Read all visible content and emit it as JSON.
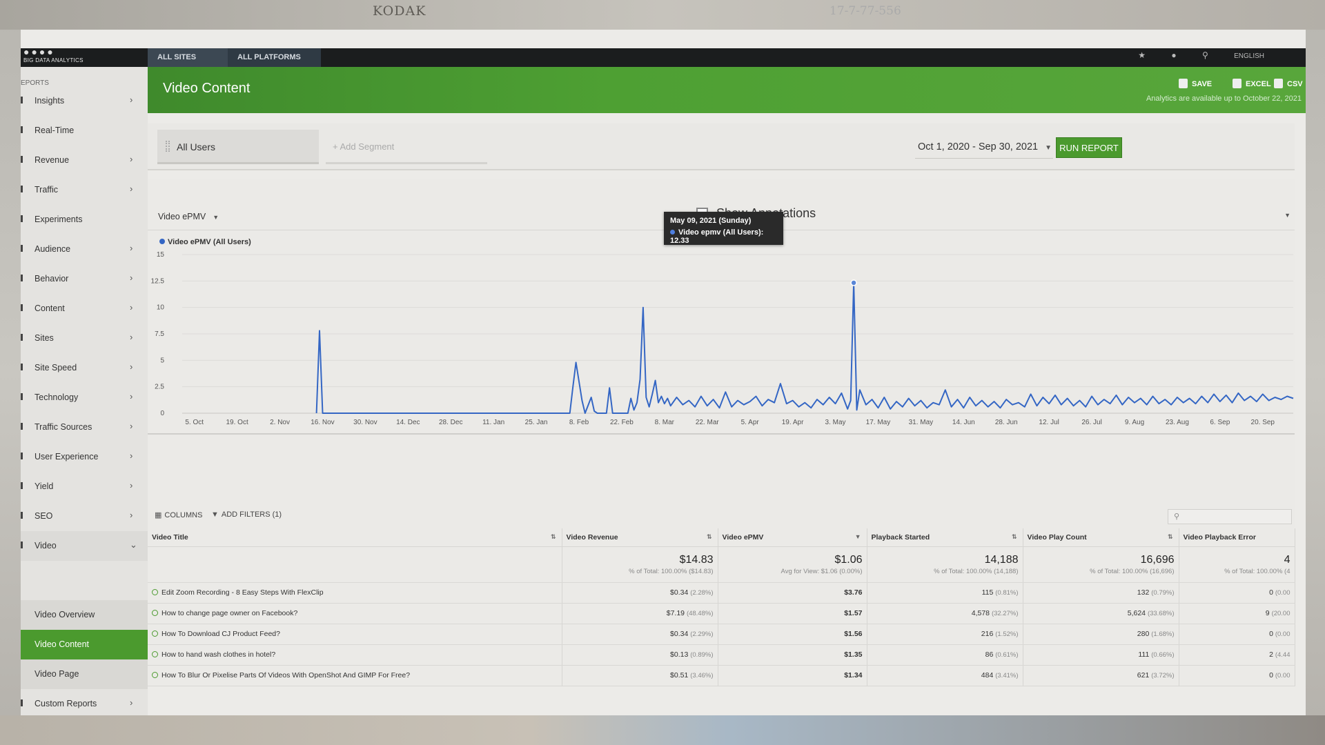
{
  "film": {
    "brand": "KODAK",
    "frame_code": "17-7-77-556"
  },
  "topbar": {
    "logo_tagline": "BIG DATA ANALYTICS",
    "tabs": [
      "ALL SITES",
      "ALL PLATFORMS"
    ],
    "language": "ENGLISH"
  },
  "sidebar": {
    "section_label": "EPORTS",
    "items": [
      {
        "label": "Insights",
        "chevron": true
      },
      {
        "label": "Real-Time",
        "chevron": false
      },
      {
        "label": "Revenue",
        "chevron": true
      },
      {
        "label": "Traffic",
        "chevron": true
      },
      {
        "label": "Experiments",
        "chevron": false
      },
      {
        "label": "Audience",
        "chevron": true
      },
      {
        "label": "Behavior",
        "chevron": true
      },
      {
        "label": "Content",
        "chevron": true
      },
      {
        "label": "Sites",
        "chevron": true
      },
      {
        "label": "Site Speed",
        "chevron": true
      },
      {
        "label": "Technology",
        "chevron": true
      },
      {
        "label": "Traffic Sources",
        "chevron": true
      },
      {
        "label": "User Experience",
        "chevron": true
      },
      {
        "label": "Yield",
        "chevron": true
      },
      {
        "label": "SEO",
        "chevron": true
      },
      {
        "label": "Video",
        "chevron": true
      }
    ],
    "video_sub": [
      "Video Overview",
      "Video Content",
      "Video Page"
    ],
    "active_sub": "Video Content",
    "custom_reports": "Custom Reports"
  },
  "header": {
    "title": "Video Content",
    "save": "SAVE",
    "excel": "EXCEL",
    "csv": "CSV",
    "availability": "Analytics are available up to October 22, 2021"
  },
  "segments": {
    "segment1": "All Users",
    "add_segment": "+ Add Segment",
    "date_range": "Oct 1, 2020 - Sep 30, 2021",
    "run_report": "RUN REPORT"
  },
  "chart_panel": {
    "metric": "Video ePMV",
    "show_annotations": "Show Annotations",
    "tooltip_date": "May 09, 2021 (Sunday)",
    "tooltip_value": "Video epmv (All Users): 12.33"
  },
  "chart_data": {
    "type": "line",
    "series": [
      {
        "name": "Video ePMV (All Users)",
        "color": "#3466c4"
      }
    ],
    "ylim": [
      0,
      15
    ],
    "yticks": [
      "0",
      "2.5",
      "5",
      "7.5",
      "10",
      "12.5",
      "15"
    ],
    "xticks": [
      "5. Oct",
      "19. Oct",
      "2. Nov",
      "16. Nov",
      "30. Nov",
      "14. Dec",
      "28. Dec",
      "11. Jan",
      "25. Jan",
      "8. Feb",
      "22. Feb",
      "8. Mar",
      "22. Mar",
      "5. Apr",
      "19. Apr",
      "3. May",
      "17. May",
      "31. May",
      "14. Jun",
      "28. Jun",
      "12. Jul",
      "26. Jul",
      "9. Aug",
      "23. Aug",
      "6. Sep",
      "20. Sep"
    ],
    "x_start": "2020-10-01",
    "x_end": "2021-09-30",
    "points": [
      [
        "2020-11-14",
        0
      ],
      [
        "2020-11-15",
        7.8
      ],
      [
        "2020-11-16",
        0
      ],
      [
        "2021-02-05",
        0
      ],
      [
        "2021-02-06",
        2.5
      ],
      [
        "2021-02-07",
        4.8
      ],
      [
        "2021-02-08",
        3.0
      ],
      [
        "2021-02-09",
        1.2
      ],
      [
        "2021-02-10",
        0
      ],
      [
        "2021-02-12",
        1.5
      ],
      [
        "2021-02-13",
        0.2
      ],
      [
        "2021-02-14",
        0
      ],
      [
        "2021-02-17",
        0
      ],
      [
        "2021-02-18",
        2.4
      ],
      [
        "2021-02-19",
        0
      ],
      [
        "2021-02-24",
        0
      ],
      [
        "2021-02-25",
        1.4
      ],
      [
        "2021-02-26",
        0.3
      ],
      [
        "2021-02-27",
        1.0
      ],
      [
        "2021-02-28",
        3.2
      ],
      [
        "2021-03-01",
        10.0
      ],
      [
        "2021-03-02",
        1.5
      ],
      [
        "2021-03-03",
        0.6
      ],
      [
        "2021-03-04",
        1.8
      ],
      [
        "2021-03-05",
        3.1
      ],
      [
        "2021-03-06",
        1.0
      ],
      [
        "2021-03-07",
        1.6
      ],
      [
        "2021-03-08",
        0.9
      ],
      [
        "2021-03-09",
        1.4
      ],
      [
        "2021-03-10",
        0.7
      ],
      [
        "2021-03-12",
        1.5
      ],
      [
        "2021-03-14",
        0.8
      ],
      [
        "2021-03-16",
        1.2
      ],
      [
        "2021-03-18",
        0.6
      ],
      [
        "2021-03-20",
        1.6
      ],
      [
        "2021-03-22",
        0.7
      ],
      [
        "2021-03-24",
        1.3
      ],
      [
        "2021-03-26",
        0.5
      ],
      [
        "2021-03-28",
        2.0
      ],
      [
        "2021-03-30",
        0.6
      ],
      [
        "2021-04-01",
        1.2
      ],
      [
        "2021-04-03",
        0.8
      ],
      [
        "2021-04-05",
        1.1
      ],
      [
        "2021-04-07",
        1.6
      ],
      [
        "2021-04-09",
        0.7
      ],
      [
        "2021-04-11",
        1.3
      ],
      [
        "2021-04-13",
        1.0
      ],
      [
        "2021-04-15",
        2.8
      ],
      [
        "2021-04-17",
        0.9
      ],
      [
        "2021-04-19",
        1.2
      ],
      [
        "2021-04-21",
        0.6
      ],
      [
        "2021-04-23",
        1.0
      ],
      [
        "2021-04-25",
        0.5
      ],
      [
        "2021-04-27",
        1.3
      ],
      [
        "2021-04-29",
        0.8
      ],
      [
        "2021-05-01",
        1.5
      ],
      [
        "2021-05-03",
        0.9
      ],
      [
        "2021-05-05",
        1.9
      ],
      [
        "2021-05-07",
        0.4
      ],
      [
        "2021-05-08",
        1.2
      ],
      [
        "2021-05-09",
        12.33
      ],
      [
        "2021-05-10",
        0.3
      ],
      [
        "2021-05-11",
        2.2
      ],
      [
        "2021-05-13",
        0.8
      ],
      [
        "2021-05-15",
        1.3
      ],
      [
        "2021-05-17",
        0.5
      ],
      [
        "2021-05-19",
        1.5
      ],
      [
        "2021-05-21",
        0.4
      ],
      [
        "2021-05-23",
        1.1
      ],
      [
        "2021-05-25",
        0.6
      ],
      [
        "2021-05-27",
        1.4
      ],
      [
        "2021-05-29",
        0.7
      ],
      [
        "2021-05-31",
        1.2
      ],
      [
        "2021-06-02",
        0.5
      ],
      [
        "2021-06-04",
        1.0
      ],
      [
        "2021-06-06",
        0.8
      ],
      [
        "2021-06-08",
        2.2
      ],
      [
        "2021-06-10",
        0.6
      ],
      [
        "2021-06-12",
        1.3
      ],
      [
        "2021-06-14",
        0.5
      ],
      [
        "2021-06-16",
        1.5
      ],
      [
        "2021-06-18",
        0.7
      ],
      [
        "2021-06-20",
        1.2
      ],
      [
        "2021-06-22",
        0.6
      ],
      [
        "2021-06-24",
        1.1
      ],
      [
        "2021-06-26",
        0.5
      ],
      [
        "2021-06-28",
        1.3
      ],
      [
        "2021-06-30",
        0.8
      ],
      [
        "2021-07-02",
        1.0
      ],
      [
        "2021-07-04",
        0.6
      ],
      [
        "2021-07-06",
        1.8
      ],
      [
        "2021-07-08",
        0.7
      ],
      [
        "2021-07-10",
        1.5
      ],
      [
        "2021-07-12",
        0.9
      ],
      [
        "2021-07-14",
        1.7
      ],
      [
        "2021-07-16",
        0.8
      ],
      [
        "2021-07-18",
        1.4
      ],
      [
        "2021-07-20",
        0.7
      ],
      [
        "2021-07-22",
        1.2
      ],
      [
        "2021-07-24",
        0.6
      ],
      [
        "2021-07-26",
        1.6
      ],
      [
        "2021-07-28",
        0.8
      ],
      [
        "2021-07-30",
        1.3
      ],
      [
        "2021-08-01",
        0.9
      ],
      [
        "2021-08-03",
        1.7
      ],
      [
        "2021-08-05",
        0.8
      ],
      [
        "2021-08-07",
        1.5
      ],
      [
        "2021-08-09",
        1.0
      ],
      [
        "2021-08-11",
        1.4
      ],
      [
        "2021-08-13",
        0.8
      ],
      [
        "2021-08-15",
        1.6
      ],
      [
        "2021-08-17",
        0.9
      ],
      [
        "2021-08-19",
        1.3
      ],
      [
        "2021-08-21",
        0.8
      ],
      [
        "2021-08-23",
        1.5
      ],
      [
        "2021-08-25",
        1.0
      ],
      [
        "2021-08-27",
        1.4
      ],
      [
        "2021-08-29",
        0.9
      ],
      [
        "2021-08-31",
        1.6
      ],
      [
        "2021-09-02",
        1.0
      ],
      [
        "2021-09-04",
        1.8
      ],
      [
        "2021-09-06",
        1.1
      ],
      [
        "2021-09-08",
        1.7
      ],
      [
        "2021-09-10",
        1.0
      ],
      [
        "2021-09-12",
        1.9
      ],
      [
        "2021-09-14",
        1.2
      ],
      [
        "2021-09-16",
        1.6
      ],
      [
        "2021-09-18",
        1.1
      ],
      [
        "2021-09-20",
        1.8
      ],
      [
        "2021-09-22",
        1.2
      ],
      [
        "2021-09-24",
        1.5
      ],
      [
        "2021-09-26",
        1.3
      ],
      [
        "2021-09-28",
        1.6
      ],
      [
        "2021-09-30",
        1.4
      ]
    ],
    "highlight": {
      "date": "2021-05-09",
      "value": 12.33
    }
  },
  "table": {
    "columns_btn": "COLUMNS",
    "filters_btn": "ADD FILTERS (1)",
    "headers": [
      "Video Title",
      "Video Revenue",
      "Video ePMV",
      "Playback Started",
      "Video Play Count",
      "Video Playback Error"
    ],
    "totals": {
      "revenue": "$14.83",
      "revenue_sub": "% of Total: 100.00% ($14.83)",
      "epmv": "$1.06",
      "epmv_sub": "Avg for View: $1.06 (0.00%)",
      "started": "14,188",
      "started_sub": "% of Total: 100.00% (14,188)",
      "plays": "16,696",
      "plays_sub": "% of Total: 100.00% (16,696)",
      "errors": "4",
      "errors_sub": "% of Total: 100.00% (4"
    },
    "rows": [
      {
        "title": "Edit Zoom Recording - 8 Easy Steps With FlexClip",
        "revenue": "$0.34",
        "revenue_pct": "(2.28%)",
        "epmv": "$3.76",
        "started": "115",
        "started_pct": "(0.81%)",
        "plays": "132",
        "plays_pct": "(0.79%)",
        "errors": "0",
        "errors_pct": "(0.00"
      },
      {
        "title": "How to change page owner on Facebook?",
        "revenue": "$7.19",
        "revenue_pct": "(48.48%)",
        "epmv": "$1.57",
        "started": "4,578",
        "started_pct": "(32.27%)",
        "plays": "5,624",
        "plays_pct": "(33.68%)",
        "errors": "9",
        "errors_pct": "(20.00"
      },
      {
        "title": "How To Download CJ Product Feed?",
        "revenue": "$0.34",
        "revenue_pct": "(2.29%)",
        "epmv": "$1.56",
        "started": "216",
        "started_pct": "(1.52%)",
        "plays": "280",
        "plays_pct": "(1.68%)",
        "errors": "0",
        "errors_pct": "(0.00"
      },
      {
        "title": "How to hand wash clothes in hotel?",
        "revenue": "$0.13",
        "revenue_pct": "(0.89%)",
        "epmv": "$1.35",
        "started": "86",
        "started_pct": "(0.61%)",
        "plays": "111",
        "plays_pct": "(0.66%)",
        "errors": "2",
        "errors_pct": "(4.44"
      },
      {
        "title": "How To Blur Or Pixelise Parts Of Videos With OpenShot And GIMP For Free?",
        "revenue": "$0.51",
        "revenue_pct": "(3.46%)",
        "epmv": "$1.34",
        "started": "484",
        "started_pct": "(3.41%)",
        "plays": "621",
        "plays_pct": "(3.72%)",
        "errors": "0",
        "errors_pct": "(0.00"
      }
    ]
  },
  "colors": {
    "accent": "#4b9a2e",
    "series": "#3466c4"
  }
}
